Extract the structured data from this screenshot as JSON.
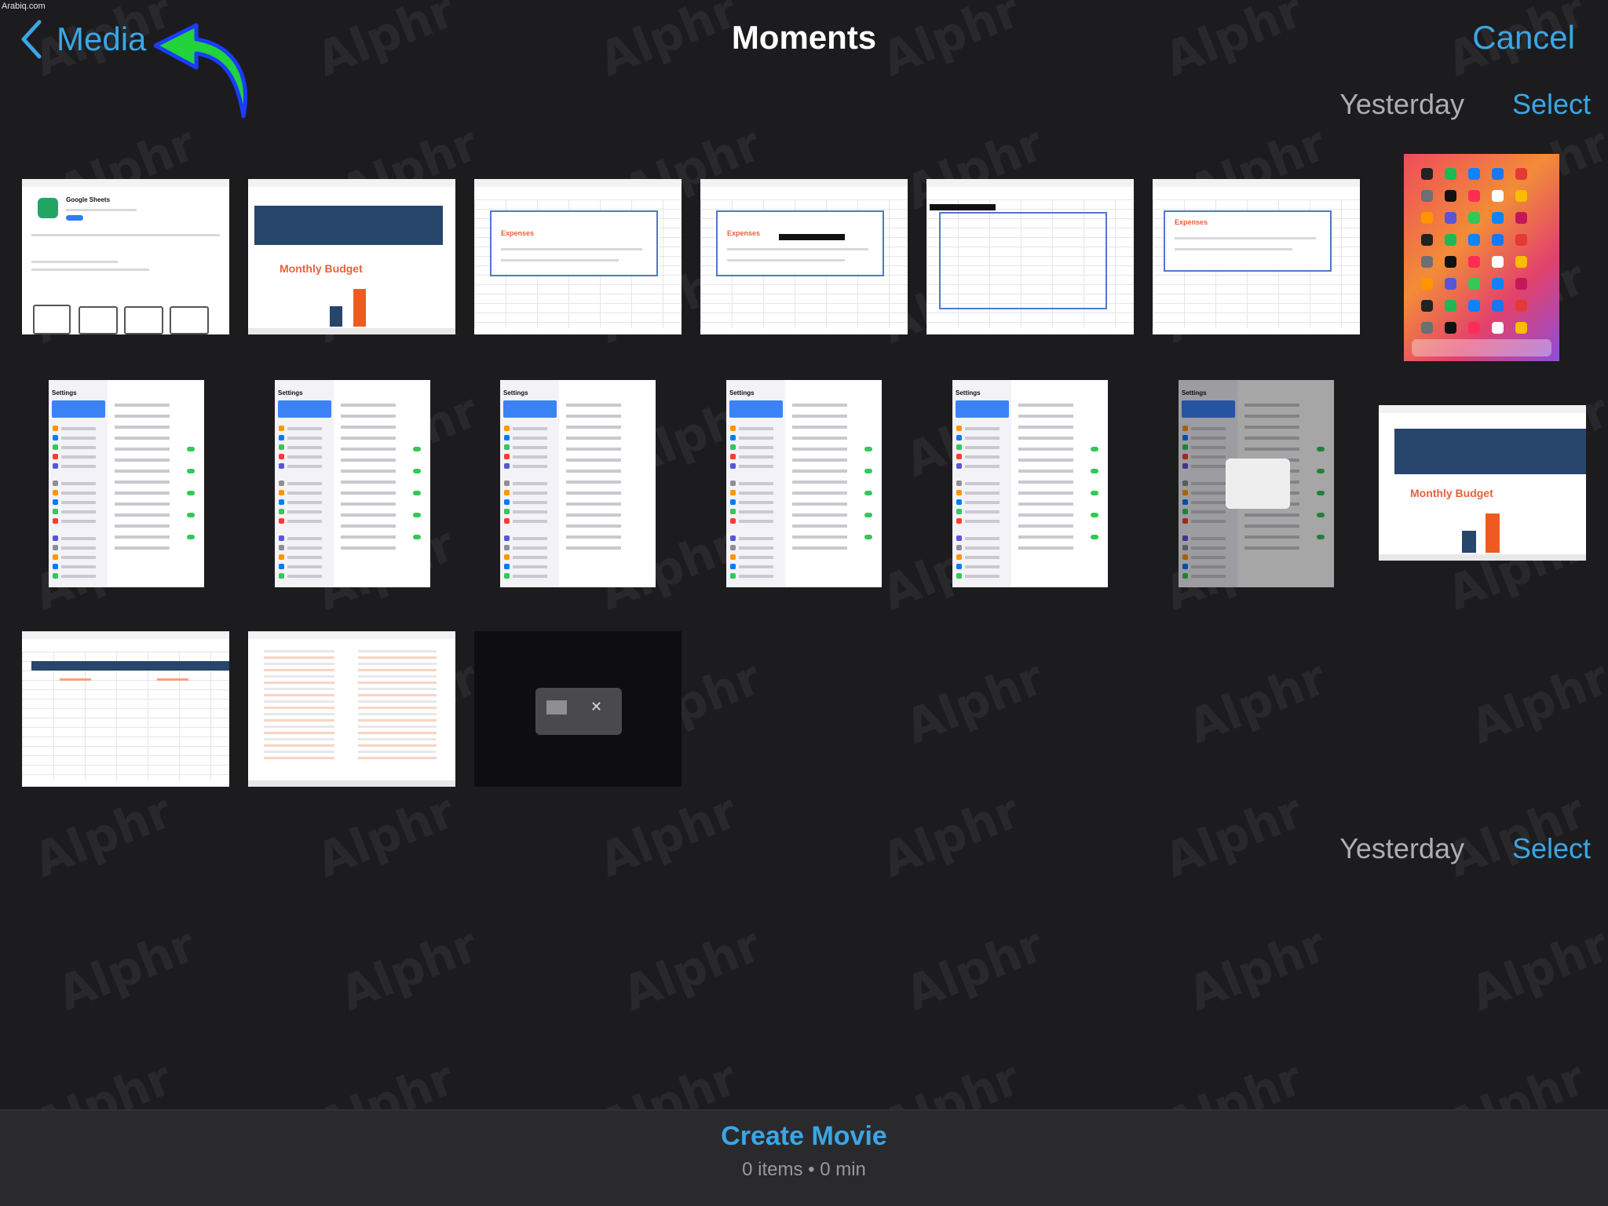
{
  "watermark_note": "Arabiq.com",
  "watermark_text": "Alphr",
  "header": {
    "back_label": "Media",
    "title": "Moments",
    "cancel_label": "Cancel"
  },
  "sections": [
    {
      "date": "Yesterday",
      "select_label": "Select"
    },
    {
      "date": "Yesterday",
      "select_label": "Select"
    }
  ],
  "thumbnails": [
    {
      "kind": "app-store",
      "caption": "Google Sheets"
    },
    {
      "kind": "budget",
      "caption": "Monthly Budget"
    },
    {
      "kind": "expenses-sheet",
      "caption": "Expenses"
    },
    {
      "kind": "expenses-sheet",
      "caption": "Expenses"
    },
    {
      "kind": "blank-sheet"
    },
    {
      "kind": "expenses-sheet",
      "caption": "Expenses"
    },
    {
      "kind": "ipad-home-screen"
    },
    {
      "kind": "settings",
      "caption": "Settings"
    },
    {
      "kind": "settings",
      "caption": "Settings"
    },
    {
      "kind": "settings",
      "caption": "Settings"
    },
    {
      "kind": "settings",
      "caption": "Settings"
    },
    {
      "kind": "settings",
      "caption": "Settings"
    },
    {
      "kind": "settings-dialog",
      "caption": "Settings"
    },
    {
      "kind": "budget",
      "caption": "Monthly Budget"
    },
    {
      "kind": "expenses-income-sheet"
    },
    {
      "kind": "expenses-income-table"
    },
    {
      "kind": "dark-new-project"
    }
  ],
  "bottom": {
    "create_label": "Create Movie",
    "items_text": "0 items",
    "separator": "•",
    "duration_text": "0 min"
  },
  "colors": {
    "background": "#1c1c1e",
    "accent": "#3aa6e6",
    "arrow": "#22d33a"
  }
}
